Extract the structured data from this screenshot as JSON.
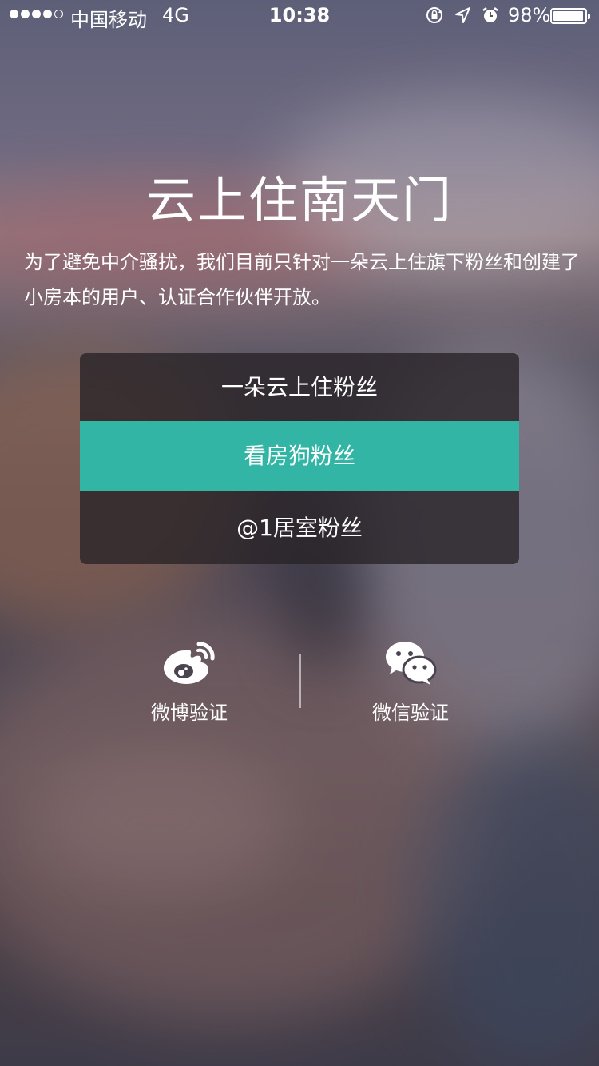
{
  "status_bar": {
    "carrier": "中国移动",
    "network": "4G",
    "time": "10:38",
    "battery_percent": "98%",
    "battery_level": 0.98,
    "signal_bars": 4,
    "icons": [
      "rotation-lock-icon",
      "location-icon",
      "alarm-icon",
      "battery-icon"
    ]
  },
  "page": {
    "title": "云上住南天门",
    "intro": "为了避免中介骚扰，我们目前只针对一朵云上住旗下粉丝和创建了小房本的用户、认证合作伙伴开放。"
  },
  "options": [
    {
      "label": "一朵云上住粉丝"
    },
    {
      "label": "看房狗粉丝",
      "selected": true
    },
    {
      "label": "@1居室粉丝"
    }
  ],
  "verify": {
    "weibo": {
      "label": "微博验证",
      "icon": "weibo-icon"
    },
    "wechat": {
      "label": "微信验证",
      "icon": "wechat-icon"
    }
  },
  "colors": {
    "accent": "#32b5a4",
    "option_panel": "#282226",
    "text": "#ffffff"
  }
}
